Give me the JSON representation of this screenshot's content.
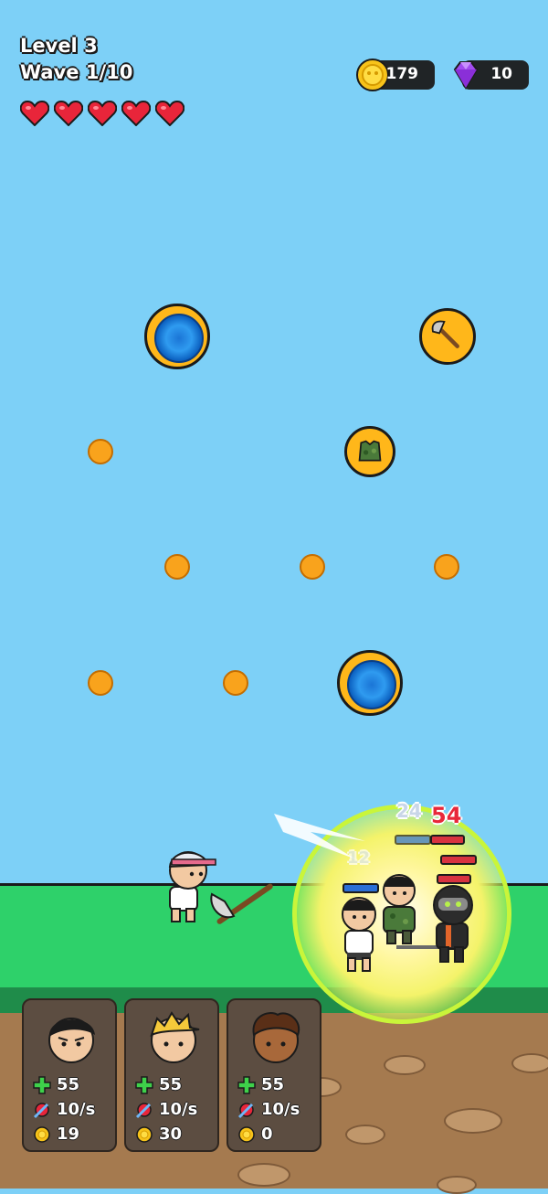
{
  "hud": {
    "level": "Level 3",
    "wave": "Wave 1/10",
    "hearts": 5
  },
  "currency": {
    "coins": "179",
    "gems": "10"
  },
  "battle": {
    "damage_numbers": [
      "24",
      "54",
      "12"
    ]
  },
  "heroes": [
    {
      "hp": "55",
      "rate": "10/s",
      "cost": "19"
    },
    {
      "hp": "55",
      "rate": "10/s",
      "cost": "30"
    },
    {
      "hp": "55",
      "rate": "10/s",
      "cost": "0"
    }
  ],
  "colors": {
    "sky": "#7dd0f7",
    "grass": "#2ed16a",
    "dirt": "#a57a4f",
    "coin": "#f9a31c",
    "heart": "#e8253a"
  }
}
